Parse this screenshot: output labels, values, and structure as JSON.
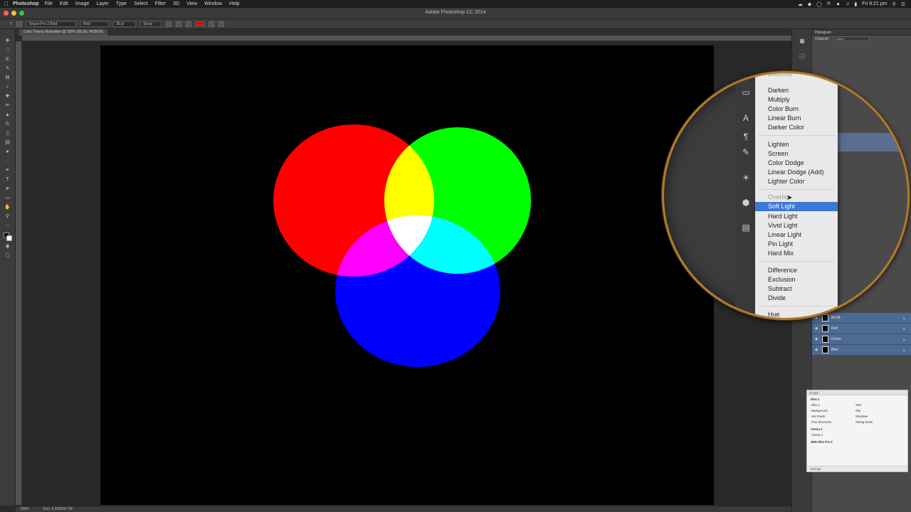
{
  "menubar": {
    "app": "Photoshop",
    "items": [
      "File",
      "Edit",
      "Image",
      "Layer",
      "Type",
      "Select",
      "Filter",
      "3D",
      "View",
      "Window",
      "Help"
    ],
    "clock": "Fri 8:21 pm"
  },
  "window": {
    "title": "Adobe Photoshop CC 2014"
  },
  "options": {
    "font_family": "Segoe Pro 2 Bold",
    "font_style": "Bold",
    "font_size": "36 pt",
    "antialias": "Sharp",
    "text_color": "#e00000"
  },
  "document": {
    "tab_title": "Color Theory Illustration @ 100% (BLUE, RGB/16)"
  },
  "canvas": {
    "background": "#000000",
    "circles": [
      {
        "name": "red",
        "color": "#ff0000"
      },
      {
        "name": "green",
        "color": "#00ff00"
      },
      {
        "name": "blue",
        "color": "#0000ff"
      }
    ]
  },
  "status": {
    "zoom": "100%",
    "doc_size": "Doc: 3.25M/18.7M"
  },
  "panels": {
    "histogram_title": "Histogram",
    "channel_label": "Channel:",
    "channel_value": "Colors",
    "layers": [
      {
        "name": "BLUE",
        "fx": "fx"
      },
      {
        "name": "Red",
        "fx": "fx"
      },
      {
        "name": "Green",
        "fx": "fx"
      },
      {
        "name": "Blue",
        "fx": "fx"
      }
    ]
  },
  "nik": {
    "header": "Google",
    "section1": "Efex 2",
    "rows": [
      [
        "Efex 2",
        "Skin"
      ],
      [
        "Background",
        "Sky"
      ],
      [
        "Hot Pixels",
        "Shadows"
      ],
      [
        "Fine Structures",
        "Strong Noise"
      ]
    ],
    "section2": "Viveza 2",
    "row2": "Viveza 2",
    "section3": "HDR Efex Pro 2",
    "footer": "Settings"
  },
  "blend_menu": {
    "items": [
      {
        "label": "Dissolve",
        "state": "dim"
      },
      {
        "label": "Darken",
        "state": ""
      },
      {
        "label": "Multiply",
        "state": ""
      },
      {
        "label": "Color Burn",
        "state": ""
      },
      {
        "label": "Linear Burn",
        "state": ""
      },
      {
        "label": "Darker Color",
        "state": ""
      },
      {
        "label": "Lighten",
        "state": ""
      },
      {
        "label": "Screen",
        "state": ""
      },
      {
        "label": "Color Dodge",
        "state": ""
      },
      {
        "label": "Linear Dodge (Add)",
        "state": ""
      },
      {
        "label": "Lighter Color",
        "state": ""
      },
      {
        "label": "Overlay",
        "state": "dim"
      },
      {
        "label": "Soft Light",
        "state": "selected"
      },
      {
        "label": "Hard Light",
        "state": ""
      },
      {
        "label": "Vivid Light",
        "state": ""
      },
      {
        "label": "Linear Light",
        "state": ""
      },
      {
        "label": "Pin Light",
        "state": ""
      },
      {
        "label": "Hard Mix",
        "state": ""
      },
      {
        "label": "Difference",
        "state": ""
      },
      {
        "label": "Exclusion",
        "state": ""
      },
      {
        "label": "Subtract",
        "state": ""
      },
      {
        "label": "Divide",
        "state": ""
      },
      {
        "label": "Hue",
        "state": ""
      }
    ]
  }
}
